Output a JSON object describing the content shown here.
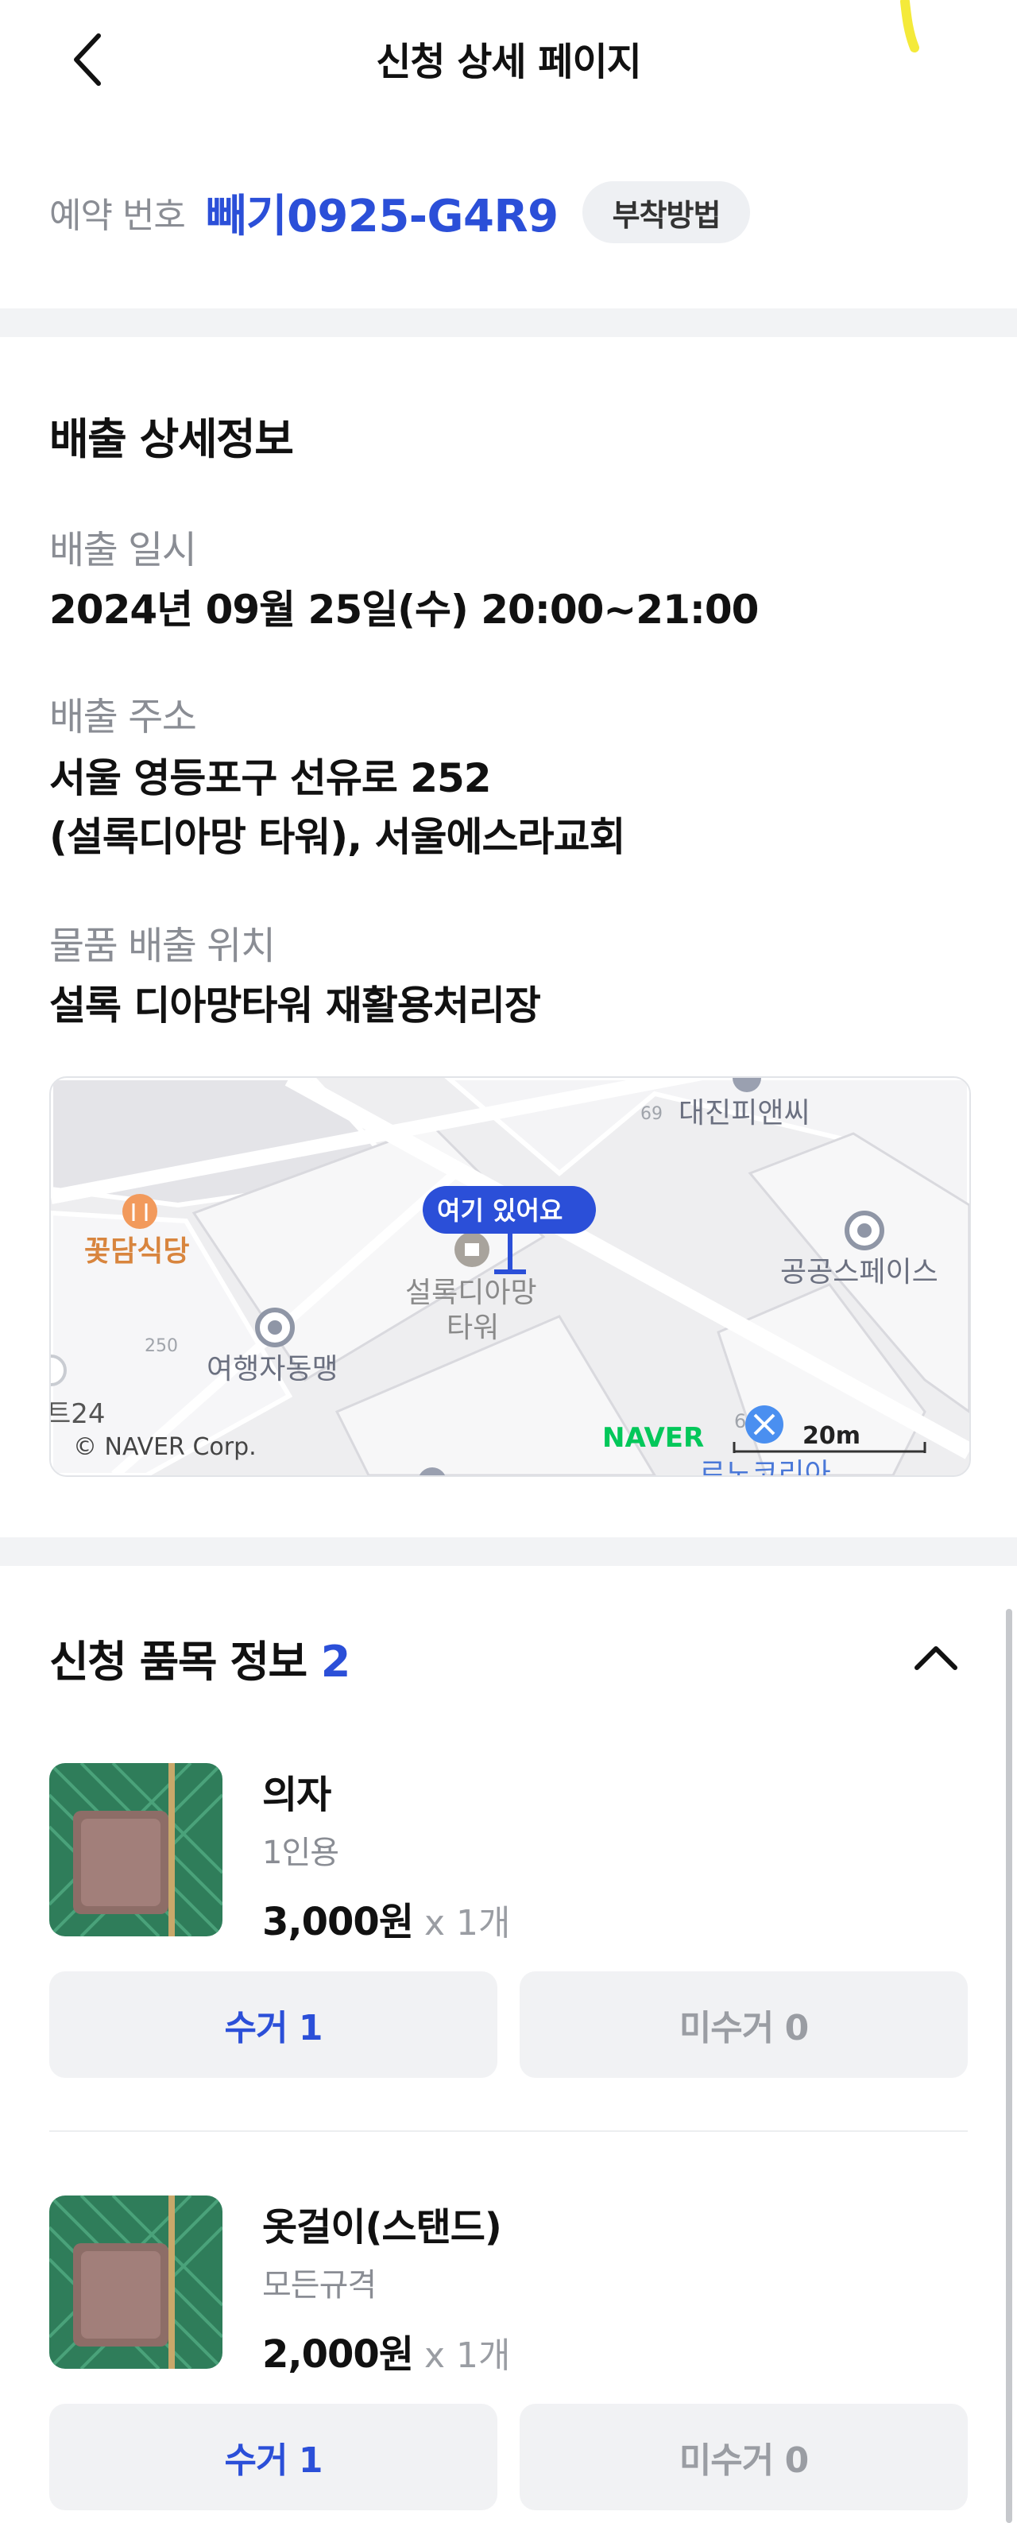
{
  "header": {
    "title": "신청 상세 페이지",
    "back_icon": "chevron-left-icon"
  },
  "reservation": {
    "label": "예약 번호",
    "number": "빼기0925-G4R9",
    "attach_button": "부착방법"
  },
  "disposal": {
    "section_title": "배출 상세정보",
    "datetime_label": "배출 일시",
    "datetime_value": "2024년 09월 25일(수) 20:00~21:00",
    "address_label": "배출 주소",
    "address_line1": "서울 영등포구 선유로 252",
    "address_line2": "(설록디아망 타워), 서울에스라교회",
    "location_label": "물품 배출 위치",
    "location_value": "설록 디아망타워 재활용처리장"
  },
  "map": {
    "marker_label": "여기 있어요",
    "building_label_line1": "설록디아망",
    "building_label_line2": "타워",
    "poi_restaurant": "꽃담식당",
    "poi_daejin": "대진피앤씨",
    "poi_daejin_number": "69",
    "poi_public": "공공스페이스",
    "poi_travel": "여행자동맹",
    "poi_travel_number": "250",
    "poi_partial_left": "트24",
    "poi_partial_bottom": "르노코리아",
    "poi_partial_bottom_number": "6",
    "provider_logo": "NAVER",
    "copyright": "© NAVER Corp.",
    "scale": "20m"
  },
  "items_section": {
    "title": "신청 품목 정보",
    "count": "2",
    "collapse_icon": "chevron-up-icon"
  },
  "items": [
    {
      "name": "의자",
      "spec": "1인용",
      "price": "3,000원",
      "qty": "x 1개",
      "collect_button": "수거 1",
      "uncollect_button": "미수거 0"
    },
    {
      "name": "옷걸이(스탠드)",
      "spec": "모든규격",
      "price": "2,000원",
      "qty": "x 1개",
      "collect_button": "수거 1",
      "uncollect_button": "미수거 0"
    }
  ],
  "colors": {
    "accent": "#2b4fd8",
    "muted_text": "#8a8d94",
    "divider": "#f2f3f5",
    "naver_green": "#03c75a"
  }
}
